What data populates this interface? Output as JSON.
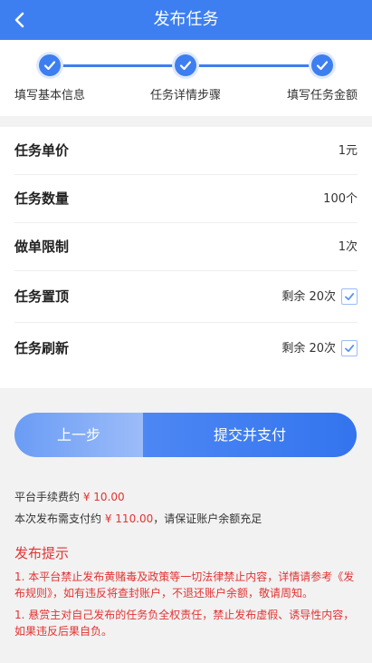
{
  "header": {
    "title": "发布任务",
    "back_icon": "chevron-left-icon"
  },
  "steps": [
    {
      "label": "填写基本信息",
      "done": true
    },
    {
      "label": "任务详情步骤",
      "done": true
    },
    {
      "label": "填写任务金额",
      "done": true
    }
  ],
  "fields": {
    "unit_price": {
      "label": "任务单价",
      "value": "1元"
    },
    "quantity": {
      "label": "任务数量",
      "value": "100个"
    },
    "limit": {
      "label": "做单限制",
      "value": "1次"
    },
    "pin_top": {
      "label": "任务置顶",
      "value": "剩余 20次",
      "checked": true
    },
    "refresh": {
      "label": "任务刷新",
      "value": "剩余 20次",
      "checked": true
    }
  },
  "buttons": {
    "prev": "上一步",
    "submit": "提交并支付"
  },
  "fees": {
    "service_fee_label": "平台手续费约",
    "service_fee_value": "¥ 10.00",
    "total_label": "本次发布需支付约",
    "total_value": "¥ 110.00",
    "total_suffix": "，请保证账户余额充足"
  },
  "notice": {
    "title": "发布提示",
    "items": [
      "1. 本平台禁止发布黄赌毒及政策等一切法律禁止内容，详情请参考《发布规则》，如有违反将查封账户，不退还账户余额，敬请周知。",
      "1. 悬赏主对自己发布的任务负全权责任，禁止发布虚假、诱导性内容，如果违反后果自负。"
    ]
  },
  "colors": {
    "primary": "#3d7ff0",
    "warning": "#e33333"
  }
}
